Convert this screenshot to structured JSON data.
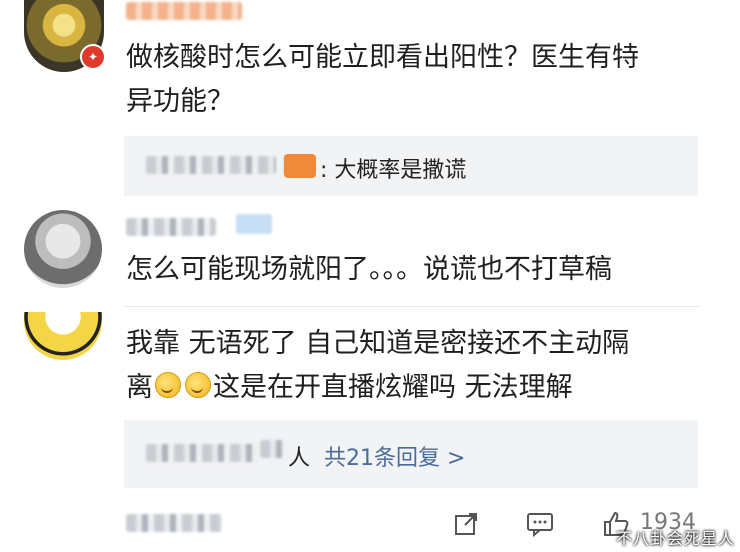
{
  "comments": [
    {
      "text_line1": "做核酸时怎么可能立即看出阳性？医生有特",
      "text_line2": "异功能？",
      "reply_preview": ": 大概率是撒谎"
    },
    {
      "text_line1": "怎么可能现场就阳了。。。说谎也不打草稿"
    },
    {
      "text_line1": "我靠 无语死了 自己知道是密接还不主动隔",
      "text_line2_a": "离",
      "text_line2_b": "这是在开直播炫耀吗 无法理解",
      "replies_user_suffix": "人",
      "replies_count": "共21条回复 >"
    }
  ],
  "actions": {
    "share_icon": "share-icon",
    "comment_icon": "comment-icon",
    "like_icon": "thumbs-up-icon",
    "like_count": "1934"
  },
  "watermark": "不八卦会死星人",
  "colors": {
    "link": "#4a6b9c",
    "reply_bg": "#f2f3f5",
    "badge": "#e03a2e"
  }
}
